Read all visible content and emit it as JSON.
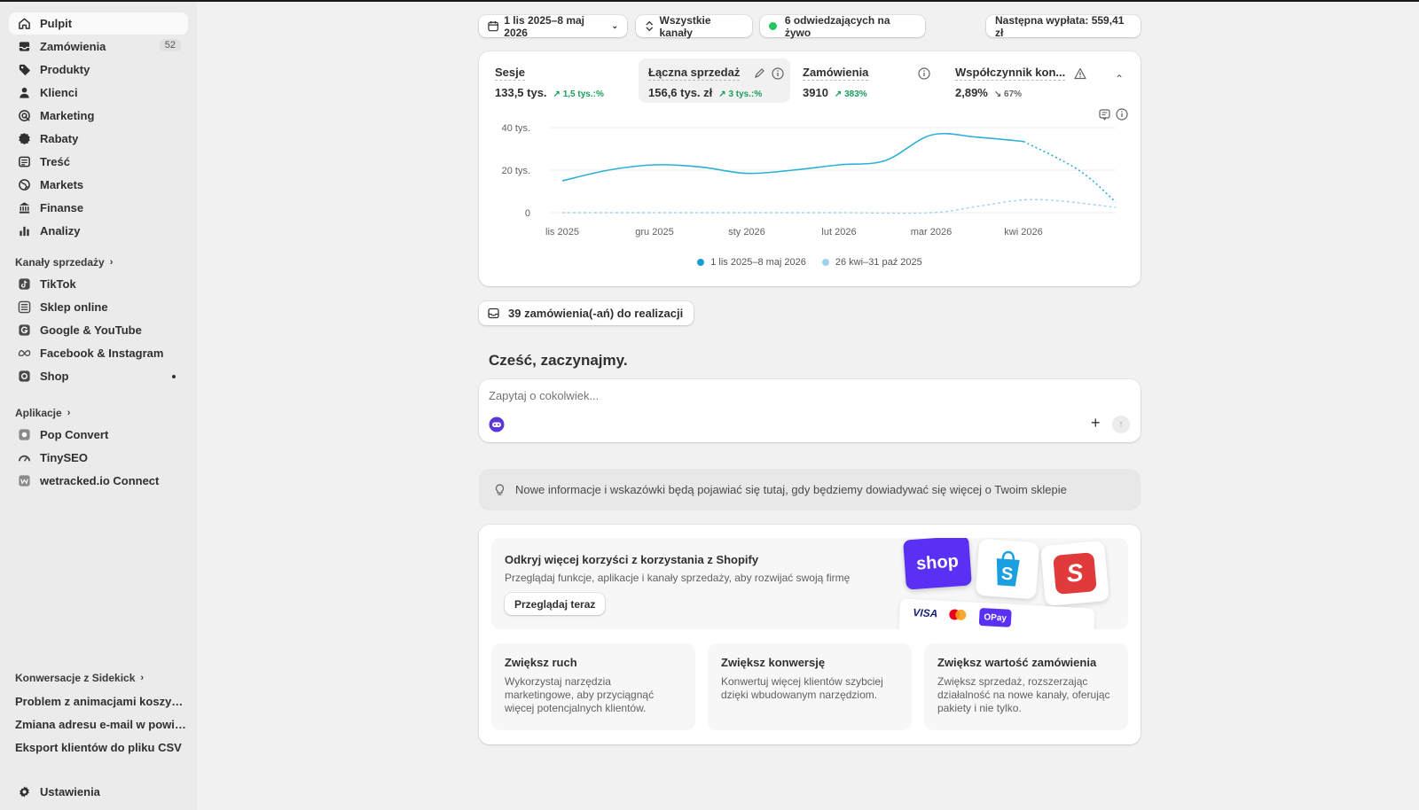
{
  "sidebar": {
    "items": [
      {
        "label": "Pulpit",
        "icon": "home-icon"
      },
      {
        "label": "Zamówienia",
        "icon": "inbox-icon",
        "badge": "52"
      },
      {
        "label": "Produkty",
        "icon": "tag-icon"
      },
      {
        "label": "Klienci",
        "icon": "person-icon"
      },
      {
        "label": "Marketing",
        "icon": "target-icon"
      },
      {
        "label": "Rabaty",
        "icon": "discount-icon"
      },
      {
        "label": "Treść",
        "icon": "content-icon"
      },
      {
        "label": "Markets",
        "icon": "globe-icon"
      },
      {
        "label": "Finanse",
        "icon": "bank-icon"
      },
      {
        "label": "Analizy",
        "icon": "bar-chart-icon"
      }
    ],
    "sales_channels_title": "Kanały sprzedaży",
    "channels": [
      {
        "label": "TikTok",
        "icon": "tiktok-icon"
      },
      {
        "label": "Sklep online",
        "icon": "store-icon"
      },
      {
        "label": "Google & YouTube",
        "icon": "google-icon"
      },
      {
        "label": "Facebook & Instagram",
        "icon": "meta-icon"
      },
      {
        "label": "Shop",
        "icon": "shop-icon"
      }
    ],
    "apps_title": "Aplikacje",
    "apps": [
      {
        "label": "Pop Convert",
        "icon": "pop-convert-icon"
      },
      {
        "label": "TinySEO",
        "icon": "tinyseo-icon"
      },
      {
        "label": "wetracked.io Connect",
        "icon": "wetracked-icon"
      }
    ],
    "conversations_title": "Konwersacje z Sidekick",
    "conversations": [
      "Problem z animacjami koszyka...",
      "Zmiana adresu e-mail w powia...",
      "Eksport klientów do pliku CSV"
    ],
    "settings_label": "Ustawienia"
  },
  "toolbar": {
    "date_range": "1 lis 2025–8 maj 2026",
    "channels": "Wszystkie kanały",
    "live_visitors": "6 odwiedzających na żywo",
    "next_payout": "Następna wypłata: 559,41 zł"
  },
  "metrics": [
    {
      "title": "Sesje",
      "value": "133,5 tys.",
      "change": "1,5 tys.:%"
    },
    {
      "title": "Łączna sprzedaż",
      "value": "156,6 tys. zł",
      "change": "3 tys.:%"
    },
    {
      "title": "Zamówienia",
      "value": "3910",
      "change": "383%"
    },
    {
      "title": "Współczynnik kon...",
      "value": "2,89%",
      "change": "67%"
    }
  ],
  "chart_data": {
    "type": "line",
    "x": [
      "lis 2025",
      "gru 2025",
      "sty 2026",
      "lut 2026",
      "mar 2026",
      "kwi 2026"
    ],
    "yticks": [
      "0",
      "20 tys.",
      "40 tys."
    ],
    "ylim": [
      0,
      40000
    ],
    "series": [
      {
        "name": "1 lis 2025–8 maj 2026",
        "color": "#2bb0d6",
        "points": [
          [
            0,
            15000
          ],
          [
            0.5,
            20000
          ],
          [
            1,
            22500
          ],
          [
            1.5,
            21500
          ],
          [
            2,
            18500
          ],
          [
            2.5,
            20000
          ],
          [
            3,
            22500
          ],
          [
            3.5,
            24500
          ],
          [
            4,
            36500
          ],
          [
            4.5,
            35500
          ],
          [
            5,
            33500
          ],
          [
            5.6,
            20000
          ],
          [
            6,
            5000
          ]
        ]
      },
      {
        "name": "26 kwi–31 paź 2025",
        "color": "#9fd3ec",
        "points": [
          [
            0,
            0
          ],
          [
            1,
            0
          ],
          [
            2,
            0
          ],
          [
            3,
            0
          ],
          [
            4,
            0
          ],
          [
            4.5,
            3000
          ],
          [
            5,
            6000
          ],
          [
            5.4,
            5500
          ],
          [
            6,
            2500
          ]
        ]
      }
    ],
    "grid": true,
    "legend": "bottom"
  },
  "orders_to_fulfill": "39 zamówienia(-ań) do realizacji",
  "greeting": "Cześć, zaczynajmy.",
  "ask": {
    "placeholder": "Zapytaj o cokolwiek..."
  },
  "tip_text": "Nowe informacje i wskazówki będą pojawiać się tutaj, gdy będziemy dowiadywać się więcej o Twoim sklepie",
  "promo": {
    "title": "Odkryj więcej korzyści z korzystania z Shopify",
    "subtitle": "Przeglądaj funkcje, aplikacje i kanały sprzedaży, aby rozwijać swoją firmę",
    "button": "Przeglądaj teraz",
    "shop_logo": "shop",
    "visa": "VISA",
    "payment": "OPay"
  },
  "tiles": [
    {
      "title": "Zwiększ ruch",
      "desc": "Wykorzystaj narzędzia marketingowe, aby przyciągnąć więcej potencjalnych klientów."
    },
    {
      "title": "Zwiększ konwersję",
      "desc": "Konwertuj więcej klientów szybciej dzięki wbudowanym narzędziom."
    },
    {
      "title": "Zwiększ wartość zamówienia",
      "desc": "Zwiększ sprzedaż, rozszerzając działalność na nowe kanały, oferując pakiety i nie tylko."
    }
  ]
}
